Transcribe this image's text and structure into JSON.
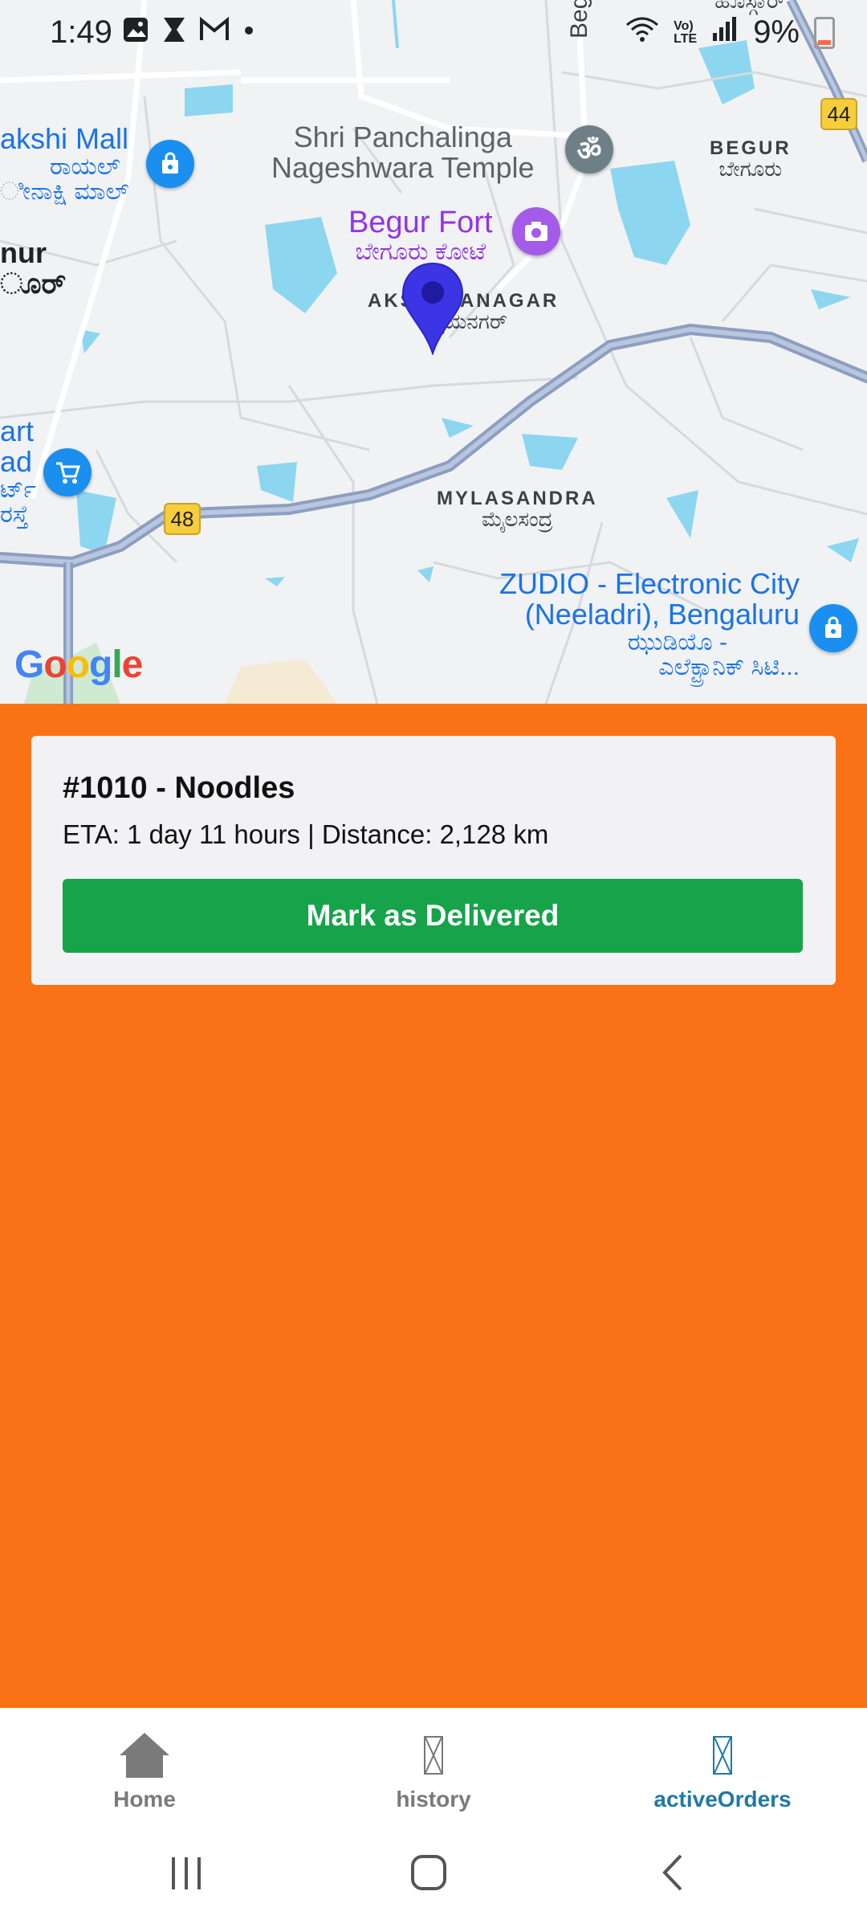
{
  "status_bar": {
    "time": "1:49",
    "battery": "9%",
    "icons": [
      "image-icon",
      "hourglass-icon",
      "gmail-icon",
      "dot-icon",
      "wifi-icon",
      "volte-icon",
      "signal-icon",
      "battery-icon"
    ]
  },
  "map": {
    "labels": {
      "mall": "akshi Mall",
      "mall_kn1": "ರಾಯಲ್",
      "mall_kn2": "ೀನಾಕ್ಷಿ ಮಾಲ್",
      "temple1": "Shri Panchalinga",
      "temple2": "Nageshwara Temple",
      "begur": "BEGUR",
      "begur_kn": "ಬೇಗೂರು",
      "fort": "Begur Fort",
      "fort_kn": "ಬೇಗೂರು ಕೋಟೆ",
      "nur": "nur",
      "nur_kn": "ೂರ್",
      "akshay": "AKSHAYANAGAR",
      "akshay_kn": "ಅಕ್ಷಯನಗರ್",
      "art": "art",
      "ad": "ad",
      "art_kn1": "ರ್ಟ್",
      "art_kn2": "ರಸ್ತೆ",
      "mylasandra": "MYLASANDRA",
      "mylasandra_kn": "ಮೈಲಸಂದ್ರ",
      "zudio1": "ZUDIO - Electronic City",
      "zudio2": "(Neeladri), Bengaluru",
      "zudio_kn1": "ಝುಡಿಯೊ -",
      "zudio_kn2": "ಎಲೆಕ್ಟ್ರಾನಿಕ್ ಸಿಟಿ...",
      "road_top": "Beg",
      "road_top_right": "ಹೊಸ್ಗಾರ್",
      "hwy44": "44",
      "hwy48": "48"
    },
    "google_logo": [
      "G",
      "o",
      "o",
      "g",
      "l",
      "e"
    ]
  },
  "order": {
    "title": "#1010 - Noodles",
    "meta": "ETA: 1 day 11 hours | Distance: 2,128 km",
    "button": "Mark as Delivered"
  },
  "bottom_nav": {
    "items": [
      {
        "label": "Home",
        "icon": "home-icon"
      },
      {
        "label": "history",
        "icon": "missing-glyph-icon"
      },
      {
        "label": "activeOrders",
        "icon": "missing-glyph-icon"
      }
    ],
    "active": "activeOrders"
  },
  "colors": {
    "accent_orange": "#f97316",
    "button_green": "#16a34a",
    "active_tab": "#1f7aa6",
    "pin_blue": "#3b35e6"
  }
}
